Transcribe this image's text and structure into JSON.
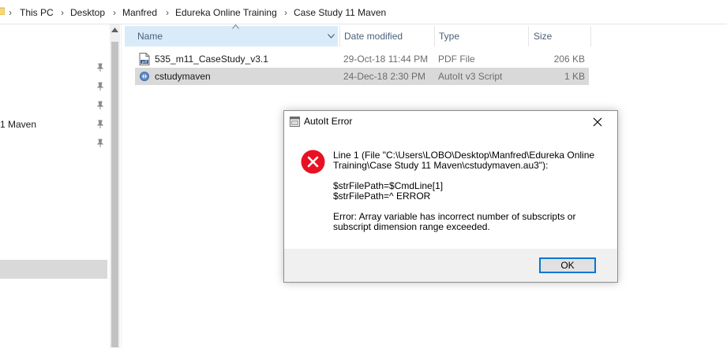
{
  "breadcrumb": {
    "items": [
      "This PC",
      "Desktop",
      "Manfred",
      "Edureka Online Training",
      "Case Study 11 Maven"
    ],
    "separator": "›"
  },
  "nav": {
    "partial_label": "1 Maven"
  },
  "columns": {
    "name": "Name",
    "date": "Date modified",
    "type": "Type",
    "size": "Size"
  },
  "files": [
    {
      "name": "535_m11_CaseStudy_v3.1",
      "date": "29-Oct-18 11:44 PM",
      "type": "PDF File",
      "size": "206 KB",
      "icon": "pdf-file-icon",
      "selected": false
    },
    {
      "name": "cstudymaven",
      "date": "24-Dec-18 2:30 PM",
      "type": "AutoIt v3 Script",
      "size": "1 KB",
      "icon": "autoit-script-icon",
      "selected": true
    }
  ],
  "dialog": {
    "title": "AutoIt Error",
    "icon": "error-icon",
    "lines": [
      "Line 1  (File \"C:\\Users\\LOBO\\Desktop\\Manfred\\Edureka Online",
      "Training\\Case Study 11 Maven\\cstudymaven.au3\"):",
      "$strFilePath=$CmdLine[1]",
      "$strFilePath=^ ERROR",
      "Error: Array variable has incorrect number of subscripts or",
      "subscript dimension range exceeded."
    ],
    "ok_label": "OK"
  },
  "colors": {
    "accent": "#0078d7",
    "error_red": "#e81123",
    "selection": "#d9d9d9",
    "column_header_hover": "#d9ebf9"
  }
}
